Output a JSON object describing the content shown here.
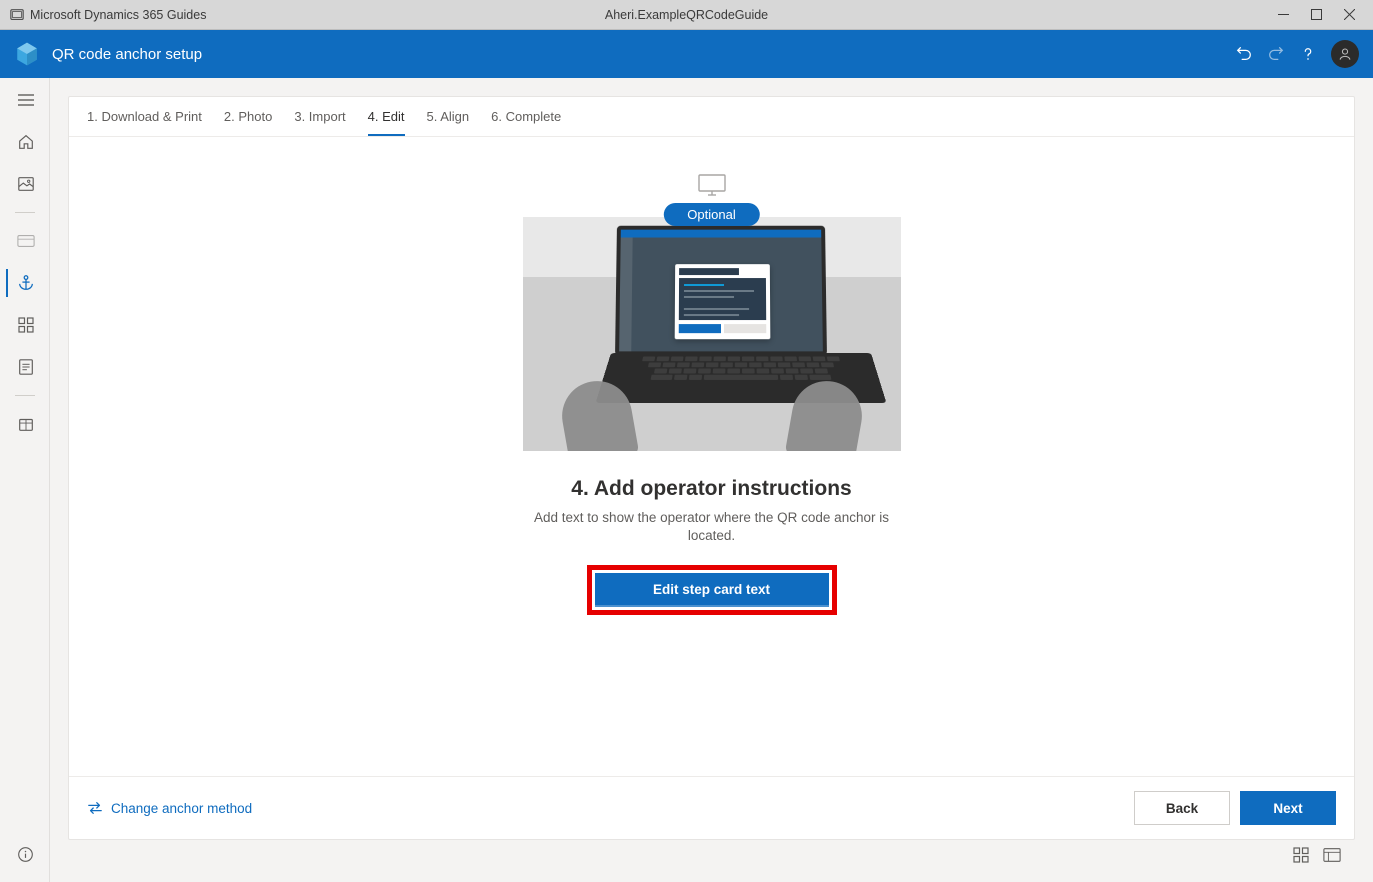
{
  "window": {
    "app_name": "Microsoft Dynamics 365 Guides",
    "document": "Aheri.ExampleQRCodeGuide"
  },
  "header": {
    "title": "QR code anchor setup"
  },
  "tabs": [
    {
      "label": "1. Download & Print"
    },
    {
      "label": "2. Photo"
    },
    {
      "label": "3. Import"
    },
    {
      "label": "4. Edit"
    },
    {
      "label": "5. Align"
    },
    {
      "label": "6. Complete"
    }
  ],
  "content": {
    "pill": "Optional",
    "title": "4. Add operator instructions",
    "description": "Add text to show the operator where the QR code anchor is located.",
    "edit_button": "Edit step card text"
  },
  "footer": {
    "change_label": "Change anchor method",
    "back": "Back",
    "next": "Next"
  }
}
